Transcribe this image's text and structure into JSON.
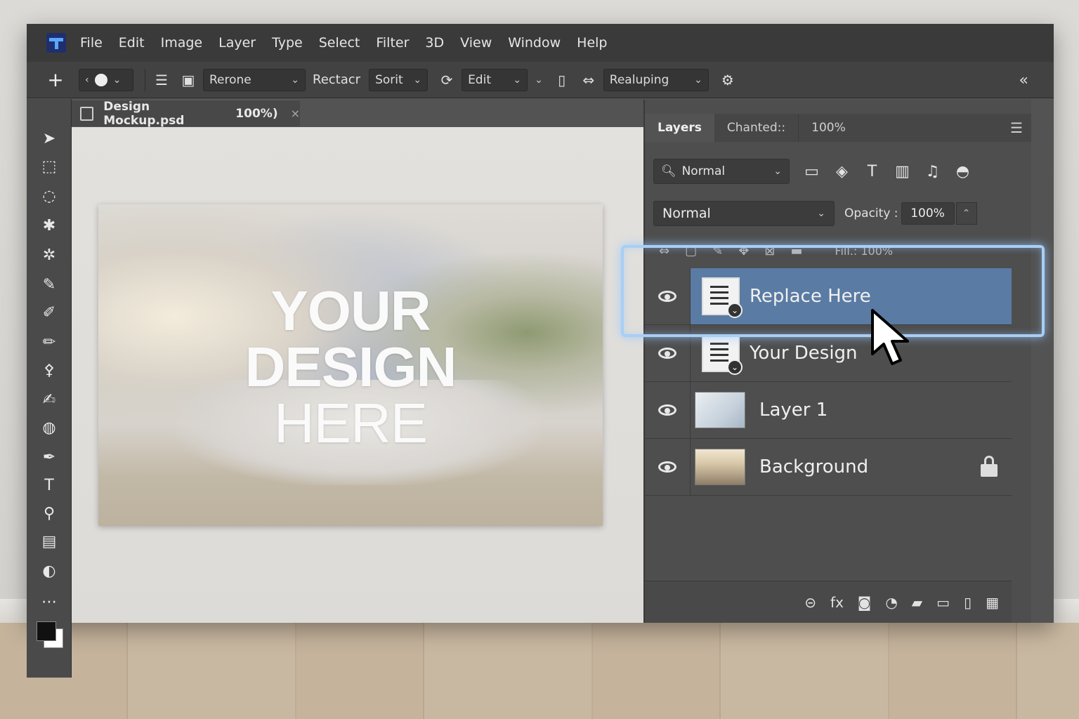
{
  "menubar": {
    "items": [
      "File",
      "Edit",
      "Image",
      "Layer",
      "Type",
      "Select",
      "Filter",
      "3D",
      "View",
      "Window",
      "Help"
    ]
  },
  "options": {
    "preset": "Rerone",
    "rect_label": "Rectacr",
    "sort_label": "Sorit",
    "edit_label": "Edit",
    "realign_label": "Realuping"
  },
  "document": {
    "tab_title": "Design Mockup.psd",
    "zoom": "100%)",
    "close": "×"
  },
  "canvas": {
    "mock_lines": [
      "YOUR",
      "DESIGN",
      "HERE"
    ]
  },
  "panel": {
    "tabs": [
      "Layers",
      "Chanted::",
      "100%"
    ],
    "filter_kind": "Normal",
    "blend_mode": "Normal",
    "opacity_label": "Opacity :",
    "opacity_value": "100%",
    "fill_label": "Fill.:  100%",
    "layers": [
      {
        "name": "Replace Here",
        "selected": true
      },
      {
        "name": "Your Design",
        "selected": false
      },
      {
        "name": "Layer 1",
        "selected": false
      },
      {
        "name": "Background",
        "selected": false,
        "locked": true
      }
    ]
  }
}
